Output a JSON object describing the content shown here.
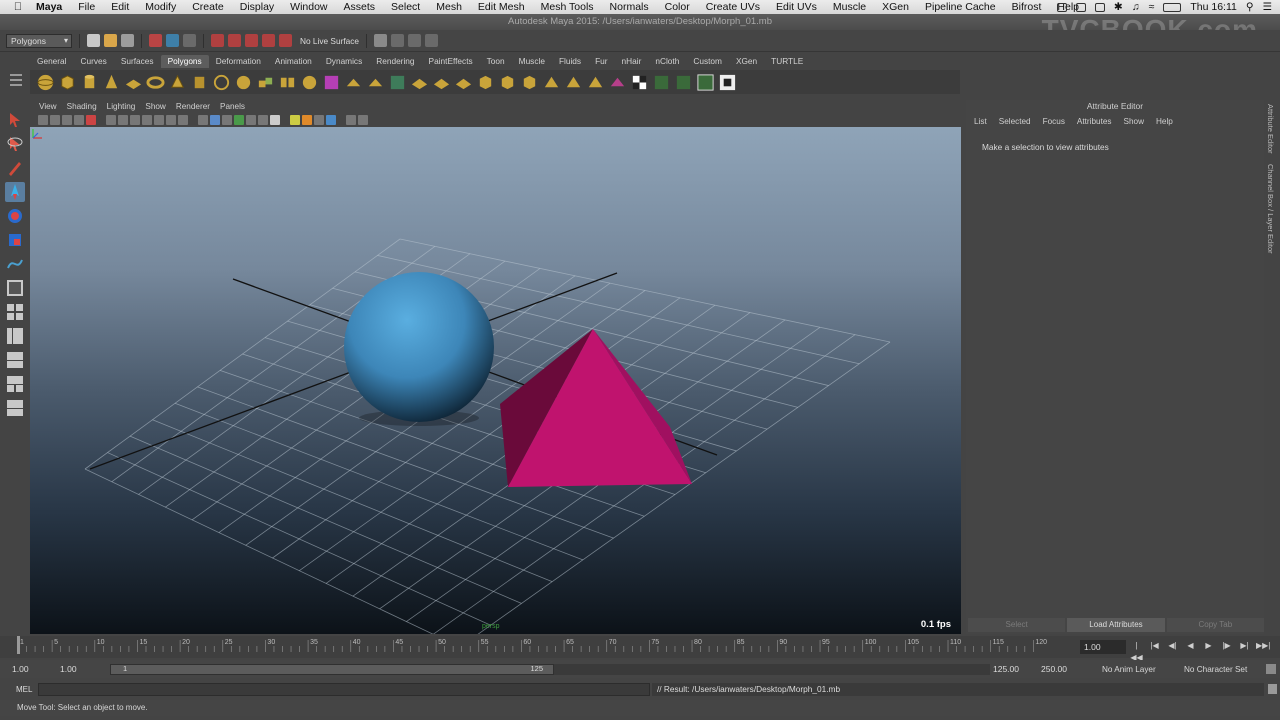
{
  "menubar": {
    "app": "Maya",
    "items": [
      "File",
      "Edit",
      "Modify",
      "Create",
      "Display",
      "Window",
      "Assets",
      "Select",
      "Mesh",
      "Edit Mesh",
      "Mesh Tools",
      "Normals",
      "Color",
      "Create UVs",
      "Edit UVs",
      "Muscle",
      "XGen",
      "Pipeline Cache",
      "Bifrost",
      "Help"
    ],
    "clock": "Thu 16:11"
  },
  "window": {
    "title": "Autodesk Maya 2015: /Users/ianwaters/Desktop/Morph_01.mb",
    "watermark": "TVCBOOK.com"
  },
  "statusline": {
    "menuset": "Polygons",
    "live_surface": "No Live Surface"
  },
  "shelf": {
    "tabs": [
      "General",
      "Curves",
      "Surfaces",
      "Polygons",
      "Deformation",
      "Animation",
      "Dynamics",
      "Rendering",
      "PaintEffects",
      "Toon",
      "Muscle",
      "Fluids",
      "Fur",
      "nHair",
      "nCloth",
      "Custom",
      "XGen",
      "TURTLE"
    ],
    "active_tab": "Polygons"
  },
  "viewport": {
    "menus": [
      "View",
      "Shading",
      "Lighting",
      "Show",
      "Renderer",
      "Panels"
    ],
    "fps": "0.1 fps",
    "camera_label": "persp",
    "colors": {
      "sphere": "#3d86b8",
      "pyramid": "#c0136e"
    }
  },
  "attribute_editor": {
    "title": "Attribute Editor",
    "menus": [
      "List",
      "Selected",
      "Focus",
      "Attributes",
      "Show",
      "Help"
    ],
    "message": "Make a selection to view attributes",
    "buttons": {
      "select": "Select",
      "load": "Load Attributes",
      "copy": "Copy Tab"
    },
    "side_tabs": [
      "Attribute Editor",
      "Channel Box / Layer Editor"
    ]
  },
  "timeslider": {
    "ticks": [
      1,
      5,
      10,
      15,
      20,
      25,
      30,
      35,
      40,
      45,
      50,
      55,
      60,
      65,
      70,
      75,
      80,
      85,
      90,
      95,
      100,
      105,
      110,
      115,
      120
    ],
    "current_frame": "1.00"
  },
  "rangeslider": {
    "start": "1.00",
    "playback_start": "1.00",
    "range_left": "1",
    "range_right": "125",
    "playback_end": "125.00",
    "end": "250.00",
    "anim_layer": "No Anim Layer",
    "character_set": "No Character Set"
  },
  "commandline": {
    "label": "MEL",
    "result": "// Result: /Users/ianwaters/Desktop/Morph_01.mb"
  },
  "helpline": "Move Tool: Select an object to move."
}
